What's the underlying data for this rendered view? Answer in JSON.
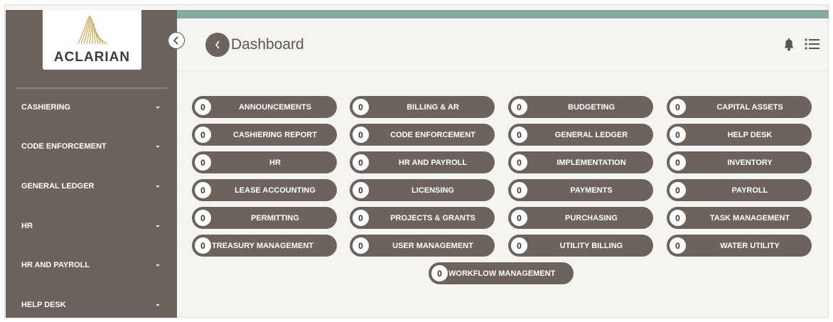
{
  "brand": {
    "name": "ACLARIAN"
  },
  "header": {
    "title": "Dashboard"
  },
  "sidebar": {
    "items": [
      {
        "label": "CASHIERING"
      },
      {
        "label": "CODE ENFORCEMENT"
      },
      {
        "label": "GENERAL LEDGER"
      },
      {
        "label": "HR"
      },
      {
        "label": "HR AND PAYROLL"
      },
      {
        "label": "HELP DESK"
      }
    ]
  },
  "modules": [
    {
      "label": "ANNOUNCEMENTS",
      "count": "0"
    },
    {
      "label": "BILLING & AR",
      "count": "0"
    },
    {
      "label": "BUDGETING",
      "count": "0"
    },
    {
      "label": "CAPITAL ASSETS",
      "count": "0"
    },
    {
      "label": "CASHIERING REPORT",
      "count": "0"
    },
    {
      "label": "CODE ENFORCEMENT",
      "count": "0"
    },
    {
      "label": "GENERAL LEDGER",
      "count": "0"
    },
    {
      "label": "HELP DESK",
      "count": "0"
    },
    {
      "label": "HR",
      "count": "0"
    },
    {
      "label": "HR AND PAYROLL",
      "count": "0"
    },
    {
      "label": "IMPLEMENTATION",
      "count": "0"
    },
    {
      "label": "INVENTORY",
      "count": "0"
    },
    {
      "label": "LEASE ACCOUNTING",
      "count": "0"
    },
    {
      "label": "LICENSING",
      "count": "0"
    },
    {
      "label": "PAYMENTS",
      "count": "0"
    },
    {
      "label": "PAYROLL",
      "count": "0"
    },
    {
      "label": "PERMITTING",
      "count": "0"
    },
    {
      "label": "PROJECTS & GRANTS",
      "count": "0"
    },
    {
      "label": "PURCHASING",
      "count": "0"
    },
    {
      "label": "TASK MANAGEMENT",
      "count": "0"
    },
    {
      "label": "TREASURY MANAGEMENT",
      "count": "0"
    },
    {
      "label": "USER MANAGEMENT",
      "count": "0"
    },
    {
      "label": "UTILITY BILLING",
      "count": "0"
    },
    {
      "label": "WATER UTILITY",
      "count": "0"
    },
    {
      "label": "WORKFLOW MANAGEMENT",
      "count": "0"
    }
  ],
  "colors": {
    "sidebar": "#6d635d",
    "accent_bar": "#86aaa3",
    "background": "#f6f4f1",
    "logo_gold": "#c9a24a"
  },
  "icons": {
    "collapse": "chevron-left-icon",
    "back": "chevron-left-icon",
    "bell": "bell-icon",
    "menu": "list-icon"
  }
}
